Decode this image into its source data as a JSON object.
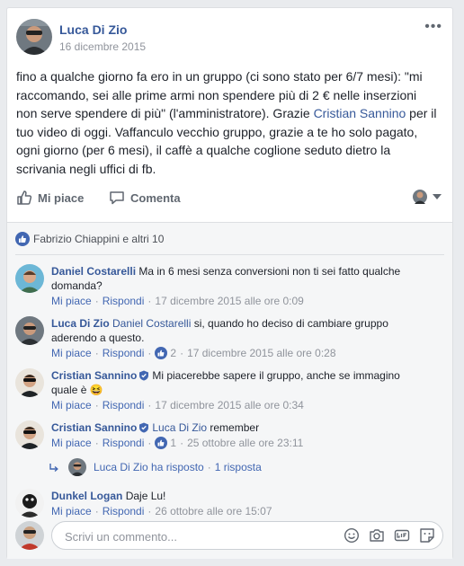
{
  "post": {
    "author": "Luca Di Zio",
    "date": "16 dicembre 2015",
    "more_label": "•••",
    "text_before_mention": "fino a qualche giorno fa ero in un gruppo (ci sono stato per 6/7 mesi): \"mi raccomando, sei alle prime armi non spendere più di 2 € nelle inserzioni non serve spendere di più\" (l'amministratore). Grazie ",
    "mention": "Cristian Sannino",
    "text_after_mention": " per il tuo video di oggi. Vaffanculo vecchio gruppo, grazie a te ho solo pagato, ogni giorno (per 6 mesi), il caffè a qualche coglione seduto dietro la scrivania negli uffici di fb."
  },
  "actions": {
    "like_label": "Mi piace",
    "comment_label": "Comenta"
  },
  "likes": {
    "text": "Fabrizio Chiappini e altri 10"
  },
  "comments": [
    {
      "author": "Daniel Costarelli",
      "text": "Ma in 6 mesi senza conversioni non ti sei fatto qualche domanda?",
      "like": "Mi piace",
      "reply": "Rispondi",
      "time": "17 dicembre 2015 alle ore 0:09"
    },
    {
      "author": "Luca Di Zio",
      "mention": "Daniel Costarelli",
      "text": " si, quando ho deciso di cambiare gruppo aderendo a questo.",
      "like": "Mi piace",
      "reply": "Rispondi",
      "reactions": "2",
      "time": "17 dicembre 2015 alle ore 0:28"
    },
    {
      "author": "Cristian Sannino",
      "text": "Mi piacerebbe sapere il gruppo, anche se immagino quale è",
      "emoji": "😆",
      "like": "Mi piace",
      "reply": "Rispondi",
      "time": "17 dicembre 2015 alle ore 0:34"
    },
    {
      "author": "Cristian Sannino",
      "mention": "Luca Di Zio",
      "text": " remember",
      "like": "Mi piace",
      "reply": "Rispondi",
      "reactions": "1",
      "time": "25 ottobre alle ore 23:11"
    },
    {
      "author": "Dunkel Logan",
      "text": "Daje Lu!",
      "like": "Mi piace",
      "reply": "Rispondi",
      "time": "26 ottobre alle ore 15:07"
    }
  ],
  "reply_summary": {
    "text": "Luca Di Zio ha risposto",
    "count": "1 risposta"
  },
  "compose": {
    "placeholder": "Scrivi un commento..."
  },
  "colors": {
    "link": "#365899",
    "accent": "#4267b2",
    "meta": "#90949c",
    "text": "#1d2129",
    "background": "#e9ebee"
  },
  "icons": [
    "more-icon",
    "thumbs-up-icon",
    "comment-icon",
    "like-badge-icon",
    "verified-icon",
    "reply-arrow-icon",
    "emoji-icon",
    "camera-icon",
    "gif-icon",
    "sticker-icon"
  ]
}
